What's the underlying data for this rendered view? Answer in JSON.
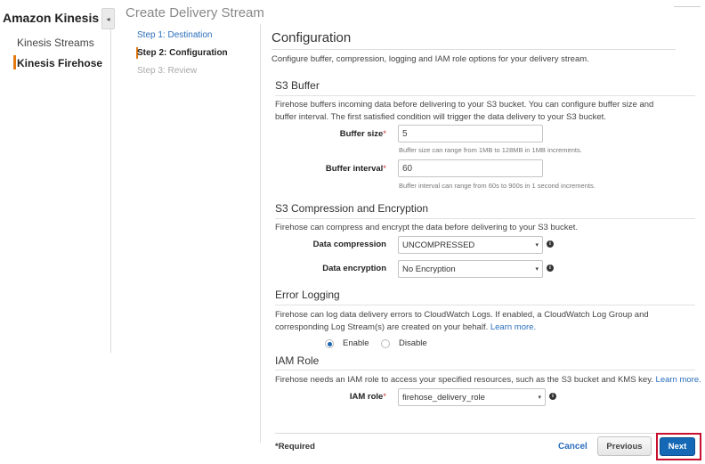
{
  "nav": {
    "brand": "Amazon Kinesis",
    "collapse_icon": "◂",
    "items": [
      {
        "label": "Kinesis Streams"
      },
      {
        "label": "Kinesis Firehose"
      }
    ]
  },
  "wizard": {
    "title": "Create Delivery Stream",
    "steps": [
      {
        "label": "Step 1: Destination"
      },
      {
        "label": "Step 2: Configuration"
      },
      {
        "label": "Step 3: Review"
      }
    ]
  },
  "config": {
    "title": "Configuration",
    "description": "Configure buffer, compression, logging and IAM role options for your delivery stream."
  },
  "s3_buffer": {
    "title": "S3 Buffer",
    "description": "Firehose buffers incoming data before delivering to your S3 bucket. You can configure buffer size and buffer interval. The first satisfied condition will trigger the data delivery to your S3 bucket.",
    "buffer_size": {
      "label": "Buffer size",
      "required_mark": "*",
      "value": "5",
      "hint": "Buffer size can range from 1MB to 128MB in 1MB increments."
    },
    "buffer_interval": {
      "label": "Buffer interval",
      "required_mark": "*",
      "value": "60",
      "hint": "Buffer interval can range from 60s to 900s in 1 second increments."
    }
  },
  "compression": {
    "title": "S3 Compression and Encryption",
    "description": "Firehose can compress and encrypt the data before delivering to your S3 bucket.",
    "data_compression": {
      "label": "Data compression",
      "value": "UNCOMPRESSED"
    },
    "data_encryption": {
      "label": "Data encryption",
      "value": "No Encryption"
    }
  },
  "error_logging": {
    "title": "Error Logging",
    "description_line1": "Firehose can log data delivery errors to CloudWatch Logs. If enabled, a CloudWatch Log Group and",
    "description_line2": "corresponding Log Stream(s) are created on your behalf.",
    "learn_more": "Learn more.",
    "enable_label": "Enable",
    "disable_label": "Disable"
  },
  "iam": {
    "title": "IAM Role",
    "description": "Firehose needs an IAM role to access your specified resources, such as the S3 bucket and KMS key.",
    "learn_more": "Learn more.",
    "role": {
      "label": "IAM role",
      "required_mark": "*",
      "value": "firehose_delivery_role"
    }
  },
  "icons": {
    "caret": "▾",
    "info": "i"
  },
  "footer": {
    "required_note": "*Required",
    "cancel_label": "Cancel",
    "previous_label": "Previous",
    "next_label": "Next"
  },
  "colors": {
    "accent": "#e47911",
    "primary_button": "#1568b6",
    "link": "#2a6ebb",
    "highlight": "#c8102e"
  }
}
